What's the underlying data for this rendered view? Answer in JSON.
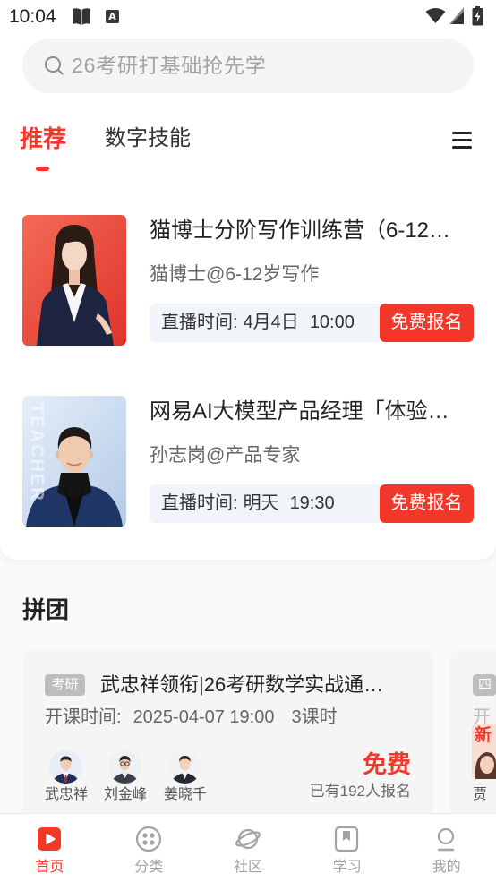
{
  "status_bar": {
    "time": "10:04",
    "app_badge_letter": "A",
    "left_icons": [
      "book-icon",
      "app-a-icon"
    ],
    "right_icons": [
      "wifi-icon",
      "signal-icon",
      "battery-charging-icon"
    ]
  },
  "search": {
    "placeholder": "26考研打基础抢先学",
    "icon": "search-icon"
  },
  "tabs": {
    "items": [
      {
        "label": "推荐",
        "active": true
      },
      {
        "label": "数字技能",
        "active": false
      }
    ],
    "menu_icon": "menu-icon"
  },
  "courses": [
    {
      "title": "猫博士分阶写作训练营（6-12…",
      "teacher": "猫博士@6-12岁写作",
      "live_label": "直播时间:",
      "live_date": "4月4日",
      "live_time": "10:00",
      "button_label": "免费报名"
    },
    {
      "title": "网易AI大模型产品经理「体验…",
      "teacher": "孙志岗@产品专家",
      "live_label": "直播时间:",
      "live_date": "明天",
      "live_time": "19:30",
      "button_label": "免费报名",
      "cover_watermark": "TEACHER"
    }
  ],
  "group_buy": {
    "section_title": "拼团",
    "cards": [
      {
        "tag": "考研",
        "title": "武忠祥领衔|26考研数学实战通…",
        "start_label": "开课时间:",
        "start_time": "2025-04-07 19:00",
        "lessons": "3课时",
        "teachers": [
          {
            "name": "武忠祥"
          },
          {
            "name": "刘金峰"
          },
          {
            "name": "姜晓千"
          }
        ],
        "price": "免费",
        "enrolled": "已有192人报名"
      },
      {
        "tag": "四",
        "start_label": "开",
        "cover_badge": "新",
        "teachers": [
          {
            "name": "贾"
          }
        ]
      }
    ]
  },
  "bottom_nav": {
    "items": [
      {
        "label": "首页",
        "icon": "home-play-icon",
        "active": true
      },
      {
        "label": "分类",
        "icon": "category-icon",
        "active": false
      },
      {
        "label": "社区",
        "icon": "planet-icon",
        "active": false
      },
      {
        "label": "学习",
        "icon": "study-bookmark-icon",
        "active": false
      },
      {
        "label": "我的",
        "icon": "profile-icon",
        "active": false
      }
    ]
  },
  "colors": {
    "accent": "#f4372b",
    "text_primary": "#222222",
    "text_secondary": "#666666",
    "nav_inactive": "#a3a3a3"
  }
}
